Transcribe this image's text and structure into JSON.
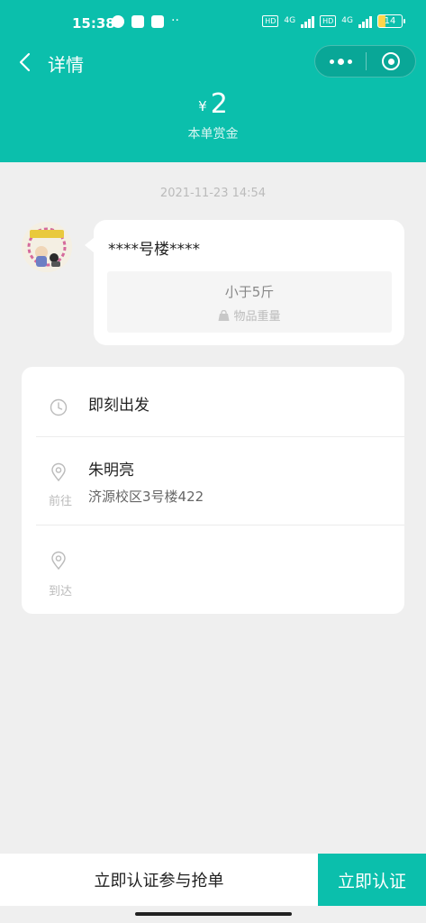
{
  "status_bar": {
    "time": "15:38",
    "hd1": "HD",
    "net1": "4G",
    "hd2": "HD",
    "net2": "4G",
    "battery": "14"
  },
  "header": {
    "title": "详情",
    "currency": "¥",
    "reward_amount": "2",
    "reward_label": "本单赏金"
  },
  "order": {
    "timestamp": "2021-11-23 14:54",
    "title": "****号楼****",
    "weight_value": "小于5斤",
    "weight_label": "物品重量"
  },
  "route": {
    "depart_time": "即刻出发",
    "from_tag": "前往",
    "from_name": "朱明亮",
    "from_address": "济源校区3号楼422",
    "to_tag": "到达"
  },
  "bottom": {
    "join_label": "立即认证参与抢单",
    "certify_label": "立即认证"
  },
  "colors": {
    "accent": "#0bbfac",
    "background": "#efefef"
  },
  "icons": [
    "back-icon",
    "more-icon",
    "close-target-icon",
    "bag-icon",
    "clock-icon",
    "location-pin-icon"
  ]
}
